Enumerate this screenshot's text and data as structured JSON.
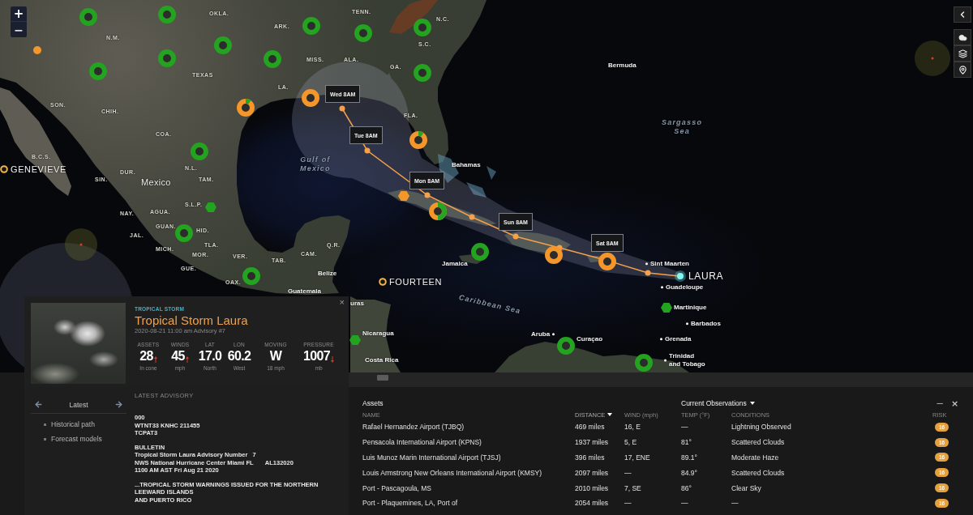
{
  "map": {
    "zoom_controls": [
      {
        "kind": "zoom_in",
        "label": "+"
      },
      {
        "kind": "zoom_out",
        "label": "−"
      }
    ],
    "labels": [
      {
        "text": "OKLA.",
        "kind": "region"
      },
      {
        "text": "TENN.",
        "kind": "region"
      },
      {
        "text": "N.C.",
        "kind": "region"
      },
      {
        "text": "ARK.",
        "kind": "region"
      },
      {
        "text": "N.M.",
        "kind": "region"
      },
      {
        "text": "S.C.",
        "kind": "region"
      },
      {
        "text": "MISS.",
        "kind": "region"
      },
      {
        "text": "ALA.",
        "kind": "region"
      },
      {
        "text": "GA.",
        "kind": "region"
      },
      {
        "text": "Bermuda",
        "kind": "place"
      },
      {
        "text": "TEXAS",
        "kind": "region"
      },
      {
        "text": "LA.",
        "kind": "region"
      },
      {
        "text": "SON.",
        "kind": "region"
      },
      {
        "text": "CHIH.",
        "kind": "region"
      },
      {
        "text": "FLA.",
        "kind": "region"
      },
      {
        "text": "COA.",
        "kind": "region"
      },
      {
        "lines": [
          "Sargasso",
          "Sea"
        ],
        "kind": "water"
      },
      {
        "text": "B.C.S.",
        "kind": "region"
      },
      {
        "text": "DUR.",
        "kind": "region"
      },
      {
        "text": "N.L.",
        "kind": "region"
      },
      {
        "lines": [
          "Gulf of",
          "Mexico"
        ],
        "kind": "water"
      },
      {
        "text": "Bahamas",
        "kind": "place"
      },
      {
        "text": "SIN.",
        "kind": "region"
      },
      {
        "text": "Mexico",
        "kind": "country"
      },
      {
        "text": "TAM.",
        "kind": "region"
      },
      {
        "text": "S.L.P.",
        "kind": "region"
      },
      {
        "text": "NAY.",
        "kind": "region"
      },
      {
        "text": "AGUA.",
        "kind": "region"
      },
      {
        "text": "GUAN.",
        "kind": "region"
      },
      {
        "text": "JAL.",
        "kind": "region"
      },
      {
        "text": "HID.",
        "kind": "region"
      },
      {
        "text": "MICH.",
        "kind": "region"
      },
      {
        "text": "TLA.",
        "kind": "region"
      },
      {
        "text": "Q.R.",
        "kind": "region"
      },
      {
        "text": "MOR.",
        "kind": "region"
      },
      {
        "text": "VER.",
        "kind": "region"
      },
      {
        "text": "TAB.",
        "kind": "region"
      },
      {
        "text": "CAM.",
        "kind": "region"
      },
      {
        "text": "GUE.",
        "kind": "region"
      },
      {
        "text": "Jamaica",
        "kind": "place"
      },
      {
        "text": "Sint Maarten",
        "kind": "town"
      },
      {
        "text": "Belize",
        "kind": "place"
      },
      {
        "text": "OAX.",
        "kind": "region"
      },
      {
        "text": "Guatemala",
        "kind": "place"
      },
      {
        "text": "Guadeloupe",
        "kind": "town"
      },
      {
        "text": "uras",
        "kind": "place"
      },
      {
        "text": "Caribbean Sea",
        "kind": "water"
      },
      {
        "text": "Martinique",
        "kind": "place"
      },
      {
        "text": "Barbados",
        "kind": "town"
      },
      {
        "text": "Nicaragua",
        "kind": "place"
      },
      {
        "text": "Aruba",
        "kind": "town"
      },
      {
        "text": "Curaçao",
        "kind": "place"
      },
      {
        "text": "Grenada",
        "kind": "town"
      },
      {
        "text": "Costa Rica",
        "kind": "place"
      },
      {
        "lines": [
          "Trinidad",
          "and Tobago"
        ],
        "kind": "town"
      }
    ],
    "storms": [
      {
        "name": "GENEVIEVE",
        "selected": false
      },
      {
        "name": "FOURTEEN",
        "selected": false
      },
      {
        "name": "LAURA",
        "selected": true
      }
    ],
    "forecast_labels": [
      "Wed 8AM",
      "Tue 8AM",
      "Mon 8AM",
      "Sun 8AM",
      "Sat 8AM"
    ],
    "markers": [
      {
        "kind": "ring",
        "color": "#23a31f"
      },
      {
        "kind": "ring",
        "color": "#23a31f"
      },
      {
        "kind": "dot",
        "color": "#f5962b"
      },
      {
        "kind": "ring",
        "color": "#23a31f"
      },
      {
        "kind": "ring",
        "color": "#23a31f"
      },
      {
        "kind": "ring",
        "color": "#23a31f"
      },
      {
        "kind": "ring",
        "color": "#23a31f"
      },
      {
        "kind": "ring",
        "color": "#23a31f"
      },
      {
        "kind": "ring",
        "color": "#23a31f"
      },
      {
        "kind": "ring",
        "color": "#23a31f"
      },
      {
        "kind": "ring",
        "color": "#23a31f"
      },
      {
        "kind": "ring",
        "color": "#f5962b"
      },
      {
        "kind": "pie",
        "color": "#f5962b"
      },
      {
        "kind": "pie",
        "color": "#f5962b"
      },
      {
        "kind": "ring",
        "color": "#23a31f"
      },
      {
        "kind": "hexagon",
        "color": "#f5962b"
      },
      {
        "kind": "hexagon",
        "color": "#23a31f"
      },
      {
        "kind": "pie",
        "color": "#f5962b"
      },
      {
        "kind": "ring",
        "color": "#23a31f"
      },
      {
        "kind": "ring",
        "color": "#23a31f"
      },
      {
        "kind": "ring",
        "color": "#f5962b"
      },
      {
        "kind": "ring",
        "color": "#f5962b"
      },
      {
        "kind": "ring",
        "color": "#23a31f"
      },
      {
        "kind": "hexagon",
        "color": "#23a31f"
      },
      {
        "kind": "hexagon",
        "color": "#23a31f"
      },
      {
        "kind": "ring",
        "color": "#23a31f"
      },
      {
        "kind": "ring",
        "color": "#23a31f"
      }
    ]
  },
  "storm_card": {
    "category": "TROPICAL STORM",
    "title": "Tropical Storm Laura",
    "issued": "2020-08-21 11:00 am Advisory #7",
    "close": "×",
    "stats": [
      {
        "label": "ASSETS",
        "value": "28",
        "unit": "In cone",
        "rising": true,
        "falling": false
      },
      {
        "label": "WINDS",
        "value": "45",
        "unit": "mph",
        "rising": true,
        "falling": false
      },
      {
        "label": "LAT",
        "value": "17.0",
        "unit": "North",
        "rising": false,
        "falling": false
      },
      {
        "label": "LON",
        "value": "60.2",
        "unit": "West",
        "rising": false,
        "falling": false
      },
      {
        "label": "MOVING",
        "value": "W",
        "unit": "18 mph",
        "rising": false,
        "falling": false
      },
      {
        "label": "PRESSURE",
        "value": "1007",
        "unit": "mb",
        "rising": false,
        "falling": true
      }
    ]
  },
  "advisory_nav": {
    "label": "Latest",
    "items": [
      "Historical path",
      "Forecast models"
    ]
  },
  "advisory": {
    "heading": "LATEST ADVISORY",
    "paragraphs": [
      [
        "000",
        "WTNT33 KNHC 211455",
        "TCPAT3"
      ],
      [
        "BULLETIN",
        "Tropical Storm Laura Advisory Number   7",
        "NWS National Hurricane Center Miami FL       AL132020",
        "1100 AM AST Fri Aug 21 2020"
      ],
      [
        "...TROPICAL STORM WARNINGS ISSUED FOR THE NORTHERN LEEWARD ISLANDS",
        "AND PUERTO RICO"
      ]
    ]
  },
  "assets": {
    "title": "Assets",
    "observations_title": "Current Observations",
    "window_controls": [
      {
        "kind": "minimize",
        "label": "−"
      },
      {
        "kind": "close",
        "label": "×"
      }
    ],
    "columns": [
      {
        "label": "NAME",
        "sorted": false
      },
      {
        "label": "DISTANCE",
        "sorted": true
      },
      {
        "label": "WIND (mph)",
        "sorted": false
      },
      {
        "label": "TEMP (°F)",
        "sorted": false
      },
      {
        "label": "CONDITIONS",
        "sorted": false
      },
      {
        "label": "RISK",
        "sorted": false
      }
    ],
    "rows": [
      {
        "cells": [
          "Rafael Hernandez Airport (TJBQ)",
          "469 miles",
          "16, E",
          "—",
          "Lightning Observed"
        ],
        "risk": "16"
      },
      {
        "cells": [
          "Pensacola International Airport (KPNS)",
          "1937 miles",
          "5, E",
          "81°",
          "Scattered Clouds"
        ],
        "risk": "16"
      },
      {
        "cells": [
          "Luis Munoz Marin International Airport (TJSJ)",
          "396 miles",
          "17, ENE",
          "89.1°",
          "Moderate Haze"
        ],
        "risk": "16"
      },
      {
        "cells": [
          "Louis Armstrong New Orleans International Airport (KMSY)",
          "2097 miles",
          "—",
          "84.9°",
          "Scattered Clouds"
        ],
        "risk": "16"
      },
      {
        "cells": [
          "Port - Pascagoula, MS",
          "2010 miles",
          "7, SE",
          "86°",
          "Clear Sky"
        ],
        "risk": "16"
      },
      {
        "cells": [
          "Port - Plaquemines, LA, Port of",
          "2054 miles",
          "—",
          "—",
          "—"
        ],
        "risk": "16"
      }
    ]
  }
}
